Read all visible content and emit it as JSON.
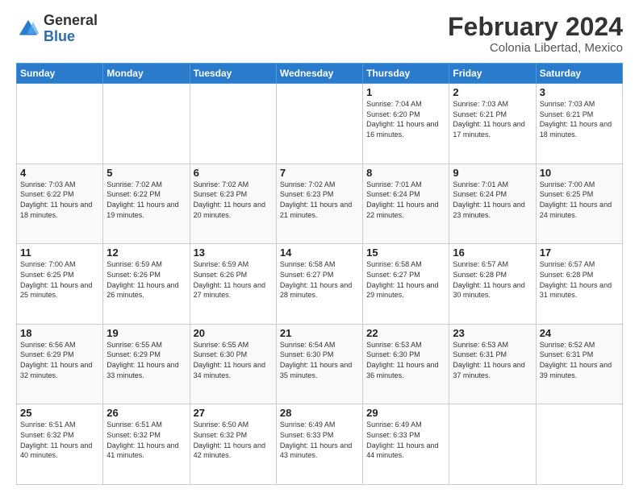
{
  "logo": {
    "general": "General",
    "blue": "Blue"
  },
  "header": {
    "title": "February 2024",
    "subtitle": "Colonia Libertad, Mexico"
  },
  "weekdays": [
    "Sunday",
    "Monday",
    "Tuesday",
    "Wednesday",
    "Thursday",
    "Friday",
    "Saturday"
  ],
  "weeks": [
    [
      {
        "day": "",
        "info": ""
      },
      {
        "day": "",
        "info": ""
      },
      {
        "day": "",
        "info": ""
      },
      {
        "day": "",
        "info": ""
      },
      {
        "day": "1",
        "info": "Sunrise: 7:04 AM\nSunset: 6:20 PM\nDaylight: 11 hours and 16 minutes."
      },
      {
        "day": "2",
        "info": "Sunrise: 7:03 AM\nSunset: 6:21 PM\nDaylight: 11 hours and 17 minutes."
      },
      {
        "day": "3",
        "info": "Sunrise: 7:03 AM\nSunset: 6:21 PM\nDaylight: 11 hours and 18 minutes."
      }
    ],
    [
      {
        "day": "4",
        "info": "Sunrise: 7:03 AM\nSunset: 6:22 PM\nDaylight: 11 hours and 18 minutes."
      },
      {
        "day": "5",
        "info": "Sunrise: 7:02 AM\nSunset: 6:22 PM\nDaylight: 11 hours and 19 minutes."
      },
      {
        "day": "6",
        "info": "Sunrise: 7:02 AM\nSunset: 6:23 PM\nDaylight: 11 hours and 20 minutes."
      },
      {
        "day": "7",
        "info": "Sunrise: 7:02 AM\nSunset: 6:23 PM\nDaylight: 11 hours and 21 minutes."
      },
      {
        "day": "8",
        "info": "Sunrise: 7:01 AM\nSunset: 6:24 PM\nDaylight: 11 hours and 22 minutes."
      },
      {
        "day": "9",
        "info": "Sunrise: 7:01 AM\nSunset: 6:24 PM\nDaylight: 11 hours and 23 minutes."
      },
      {
        "day": "10",
        "info": "Sunrise: 7:00 AM\nSunset: 6:25 PM\nDaylight: 11 hours and 24 minutes."
      }
    ],
    [
      {
        "day": "11",
        "info": "Sunrise: 7:00 AM\nSunset: 6:25 PM\nDaylight: 11 hours and 25 minutes."
      },
      {
        "day": "12",
        "info": "Sunrise: 6:59 AM\nSunset: 6:26 PM\nDaylight: 11 hours and 26 minutes."
      },
      {
        "day": "13",
        "info": "Sunrise: 6:59 AM\nSunset: 6:26 PM\nDaylight: 11 hours and 27 minutes."
      },
      {
        "day": "14",
        "info": "Sunrise: 6:58 AM\nSunset: 6:27 PM\nDaylight: 11 hours and 28 minutes."
      },
      {
        "day": "15",
        "info": "Sunrise: 6:58 AM\nSunset: 6:27 PM\nDaylight: 11 hours and 29 minutes."
      },
      {
        "day": "16",
        "info": "Sunrise: 6:57 AM\nSunset: 6:28 PM\nDaylight: 11 hours and 30 minutes."
      },
      {
        "day": "17",
        "info": "Sunrise: 6:57 AM\nSunset: 6:28 PM\nDaylight: 11 hours and 31 minutes."
      }
    ],
    [
      {
        "day": "18",
        "info": "Sunrise: 6:56 AM\nSunset: 6:29 PM\nDaylight: 11 hours and 32 minutes."
      },
      {
        "day": "19",
        "info": "Sunrise: 6:55 AM\nSunset: 6:29 PM\nDaylight: 11 hours and 33 minutes."
      },
      {
        "day": "20",
        "info": "Sunrise: 6:55 AM\nSunset: 6:30 PM\nDaylight: 11 hours and 34 minutes."
      },
      {
        "day": "21",
        "info": "Sunrise: 6:54 AM\nSunset: 6:30 PM\nDaylight: 11 hours and 35 minutes."
      },
      {
        "day": "22",
        "info": "Sunrise: 6:53 AM\nSunset: 6:30 PM\nDaylight: 11 hours and 36 minutes."
      },
      {
        "day": "23",
        "info": "Sunrise: 6:53 AM\nSunset: 6:31 PM\nDaylight: 11 hours and 37 minutes."
      },
      {
        "day": "24",
        "info": "Sunrise: 6:52 AM\nSunset: 6:31 PM\nDaylight: 11 hours and 39 minutes."
      }
    ],
    [
      {
        "day": "25",
        "info": "Sunrise: 6:51 AM\nSunset: 6:32 PM\nDaylight: 11 hours and 40 minutes."
      },
      {
        "day": "26",
        "info": "Sunrise: 6:51 AM\nSunset: 6:32 PM\nDaylight: 11 hours and 41 minutes."
      },
      {
        "day": "27",
        "info": "Sunrise: 6:50 AM\nSunset: 6:32 PM\nDaylight: 11 hours and 42 minutes."
      },
      {
        "day": "28",
        "info": "Sunrise: 6:49 AM\nSunset: 6:33 PM\nDaylight: 11 hours and 43 minutes."
      },
      {
        "day": "29",
        "info": "Sunrise: 6:49 AM\nSunset: 6:33 PM\nDaylight: 11 hours and 44 minutes."
      },
      {
        "day": "",
        "info": ""
      },
      {
        "day": "",
        "info": ""
      }
    ]
  ]
}
